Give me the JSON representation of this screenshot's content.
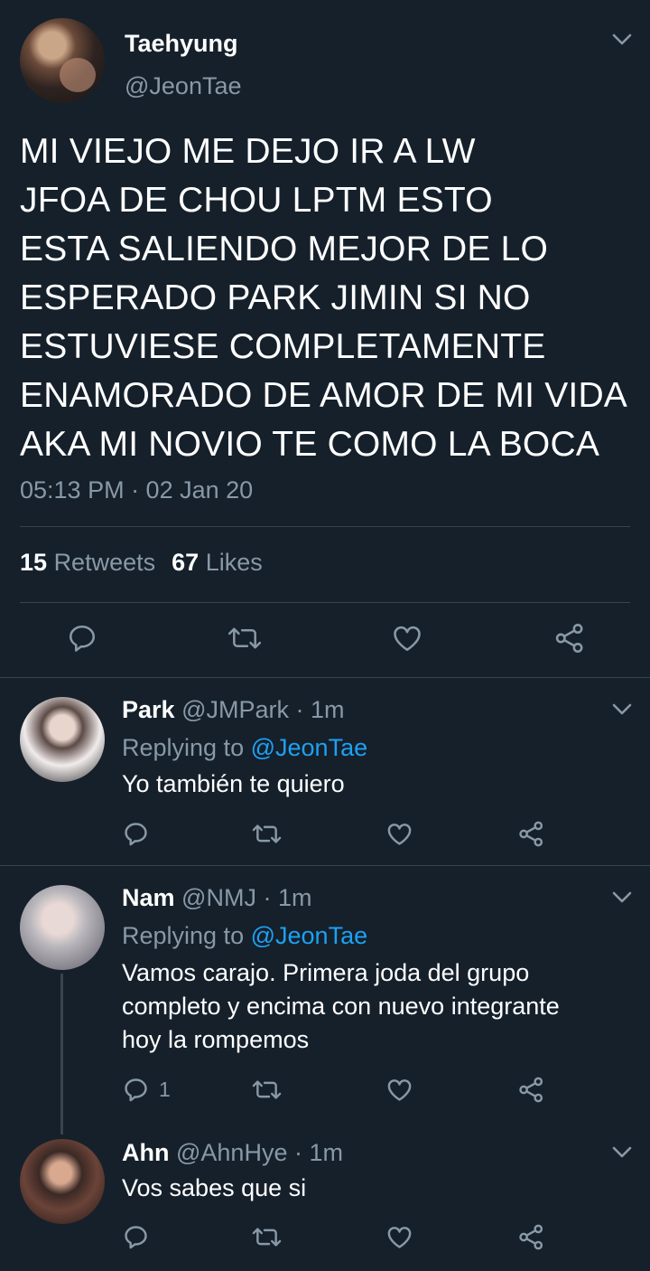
{
  "main_tweet": {
    "author_name": "Taehyung",
    "author_handle": "@JeonTae",
    "text_lines": [
      "MI VIEJO ME DEJO IR A LW",
      "JFOA DE CHOU LPTM ESTO",
      "ESTA SALIENDO MEJOR DE LO",
      "ESPERADO PARK JIMIN SI NO",
      "ESTUVIESE COMPLETAMENTE",
      "ENAMORADO DE AMOR DE MI VIDA",
      "AKA MI NOVIO TE COMO LA BOCA"
    ],
    "timestamp": "05:13 PM · 02 Jan 20",
    "retweets_count": "15",
    "retweets_label": "Retweets",
    "likes_count": "67",
    "likes_label": "Likes",
    "icons": [
      "reply-icon",
      "retweet-icon",
      "like-icon",
      "share-icon",
      "chevron-down-icon"
    ]
  },
  "replies": [
    {
      "name": "Park",
      "handle": "@JMPark",
      "time": "· 1m",
      "replying_prefix": "Replying to",
      "replying_to": "@JeonTae",
      "text_lines": [
        "Yo también te quiero"
      ],
      "reply_count": ""
    },
    {
      "name": "Nam",
      "handle": "@NMJ",
      "time": "· 1m",
      "replying_prefix": "Replying to",
      "replying_to": "@JeonTae",
      "text_lines": [
        "Vamos carajo. Primera joda del grupo",
        "completo y encima con nuevo integrante",
        "hoy la rompemos"
      ],
      "reply_count": "1"
    },
    {
      "name": "Ahn",
      "handle": "@AhnHye",
      "time": "· 1m",
      "text_lines": [
        "Vos sabes que si"
      ],
      "reply_count": ""
    }
  ],
  "colors": {
    "background": "#15202b",
    "secondary_text": "#8899a6",
    "link": "#1da1f2",
    "divider": "#38444d"
  }
}
